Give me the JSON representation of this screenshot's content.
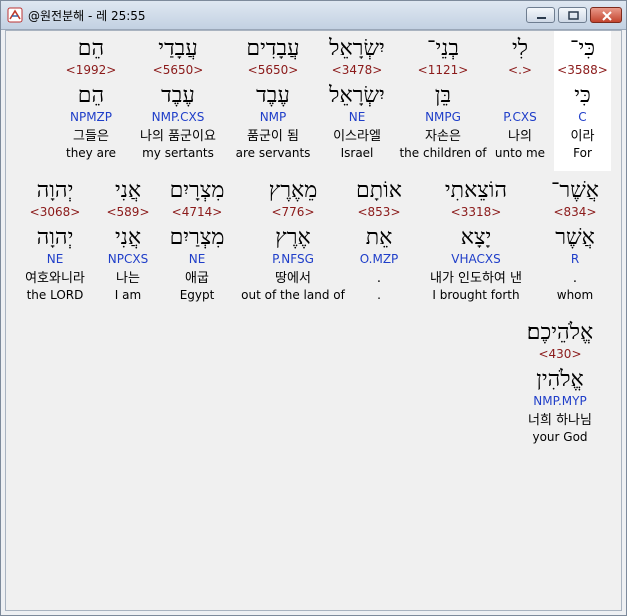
{
  "window": {
    "title": "@원전분해 - 레 25:55"
  },
  "rows": [
    {
      "words": [
        {
          "heb": "כִּי־",
          "strong": "<3588>",
          "lemma": "כִּי",
          "morph": "C",
          "kor": "이라",
          "eng": "For"
        },
        {
          "heb": "לִי",
          "strong": "<.>",
          "lemma": "",
          "morph": "P.CXS",
          "kor": "나의",
          "eng": "unto me"
        },
        {
          "heb": "בְנֵי־",
          "strong": "<1121>",
          "lemma": "בֵּן",
          "morph": "NMPG",
          "kor": "자손은",
          "eng": "the children of"
        },
        {
          "heb": "יִשְׂרָאֵל",
          "strong": "<3478>",
          "lemma": "יִשְׂרָאֵל",
          "morph": "NE",
          "kor": "이스라엘",
          "eng": "Israel"
        },
        {
          "heb": "עֲבָדִים",
          "strong": "<5650>",
          "lemma": "עֶבֶד",
          "morph": "NMP",
          "kor": "품군이 됨",
          "eng": "are servants"
        },
        {
          "heb": "עֲבָדַי",
          "strong": "<5650>",
          "lemma": "עֶבֶד",
          "morph": "NMP.CXS",
          "kor": "나의 품군이요",
          "eng": "my sertants"
        },
        {
          "heb": "הֵם",
          "strong": "<1992>",
          "lemma": "הֵם",
          "morph": "NPMZP",
          "kor": "그들은",
          "eng": "they are"
        }
      ]
    },
    {
      "words": [
        {
          "heb": "אֲשֶׁר־",
          "strong": "<834>",
          "lemma": "אֲשֶׁר",
          "morph": "R",
          "kor": ".",
          "eng": "whom"
        },
        {
          "heb": "הוֹצֵאתִי",
          "strong": "<3318>",
          "lemma": "יָצָא",
          "morph": "VHACXS",
          "kor": "내가 인도하여 낸",
          "eng": "I brought forth"
        },
        {
          "heb": "אוֹתָם",
          "strong": "<853>",
          "lemma": "אֵת",
          "morph": "O.MZP",
          "kor": ".",
          "eng": "."
        },
        {
          "heb": "מֵאֶרֶץ",
          "strong": "<776>",
          "lemma": "אֶרֶץ",
          "morph": "P.NFSG",
          "kor": "땅에서",
          "eng": "out of the land of"
        },
        {
          "heb": "מִצְרָיִם",
          "strong": "<4714>",
          "lemma": "מִצְרַיִם",
          "morph": "NE",
          "kor": "애굽",
          "eng": "Egypt"
        },
        {
          "heb": "אֲנִי",
          "strong": "<589>",
          "lemma": "אֲנִי",
          "morph": "NPCXS",
          "kor": "나는",
          "eng": "I am"
        },
        {
          "heb": "יְהוָה",
          "strong": "<3068>",
          "lemma": "יְהוָה",
          "morph": "NE",
          "kor": "여호와니라",
          "eng": "the LORD"
        }
      ]
    },
    {
      "words": [
        {
          "heb": "אֱלֹהֵיכֶם׃",
          "strong": "<430>",
          "lemma": "אֱלֹהִין",
          "morph": "NMP.MYP",
          "kor": "너희 하나님",
          "eng": "your God"
        }
      ]
    }
  ]
}
